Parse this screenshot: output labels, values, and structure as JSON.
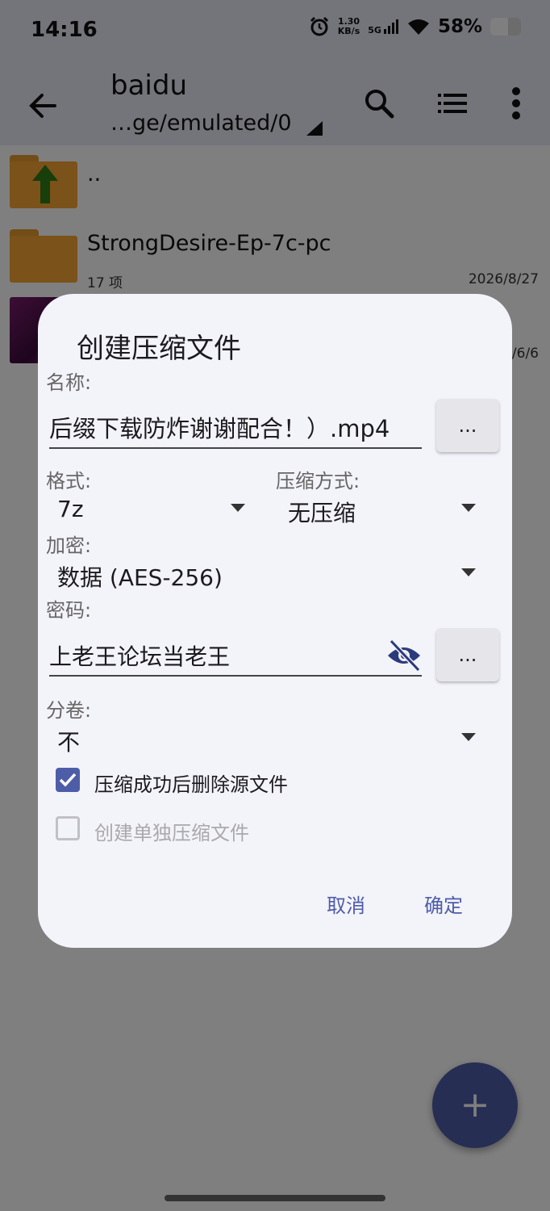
{
  "status_bar": {
    "time": "14:16",
    "net_speed_value": "1.30",
    "net_speed_unit": "KB/s",
    "signal_label": "5G",
    "battery_text": "58%",
    "battery_level": 0.58,
    "icons": [
      "alarm-icon",
      "signal-icon",
      "wifi-icon",
      "battery-icon"
    ]
  },
  "app_bar": {
    "title": "baidu",
    "path": "…ge/emulated/0",
    "icons": [
      "back-arrow-icon",
      "search-icon",
      "list-view-icon",
      "more-vert-icon"
    ]
  },
  "file_list": [
    {
      "name": "..",
      "icon": "folder-up-icon"
    },
    {
      "name": "StrongDesire-Ep-7c-pc",
      "meta": "17 项",
      "date": "2026/8/27",
      "icon": "folder-icon"
    },
    {
      "date": "/6/6",
      "icon": "video-thumbnail"
    }
  ],
  "dialog": {
    "title": "创建压缩文件",
    "name_label": "名称:",
    "name_value": "后缀下载防炸谢谢配合！）.mp4",
    "ellipsis": "...",
    "format_label": "格式:",
    "format_value": "7z",
    "compress_label": "压缩方式:",
    "compress_value": "无压缩",
    "encrypt_label": "加密:",
    "encrypt_value": "数据 (AES-256)",
    "password_label": "密码:",
    "password_value": "上老王论坛当老王",
    "volume_label": "分卷:",
    "volume_value": "不",
    "checkbox1_label": "压缩成功后删除源文件",
    "checkbox1_checked": true,
    "checkbox2_label": "创建单独压缩文件",
    "checkbox2_checked": false,
    "cancel_label": "取消",
    "ok_label": "确定",
    "accent_color": "#4e5da8"
  },
  "fab": {
    "icon": "plus-icon"
  }
}
